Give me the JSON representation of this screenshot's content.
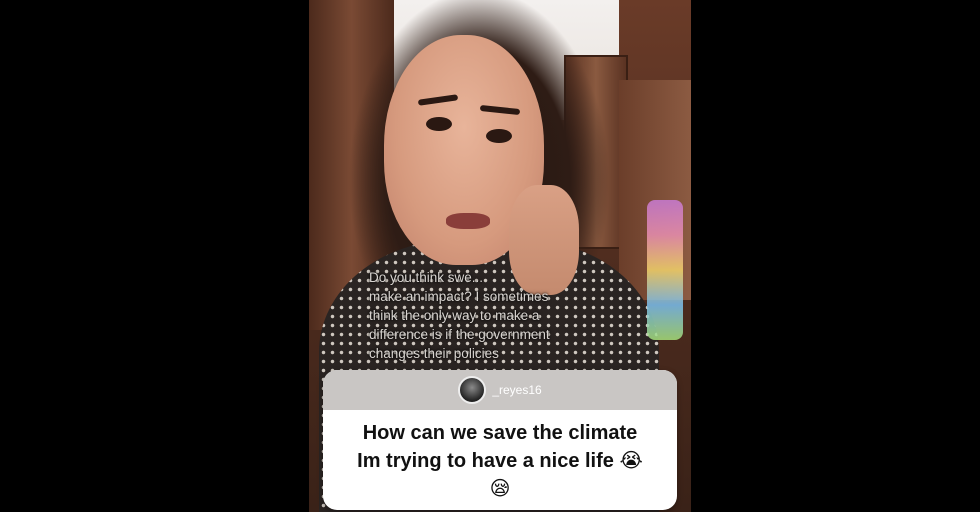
{
  "overlay_question": {
    "lines": [
      "Do you think swe...",
      "make an impact? I sometimes",
      "think the only way to make a",
      "difference is if the government",
      "changes their policies"
    ]
  },
  "question_card": {
    "username": "_reyes16",
    "lines": [
      "How can we save the climate",
      "Im trying to have a nice life"
    ],
    "emoji_1": "😭",
    "emoji_2": "😪"
  },
  "colors": {
    "background": "#000000",
    "card_header": "#c9c6c4",
    "card_body": "#ffffff"
  }
}
